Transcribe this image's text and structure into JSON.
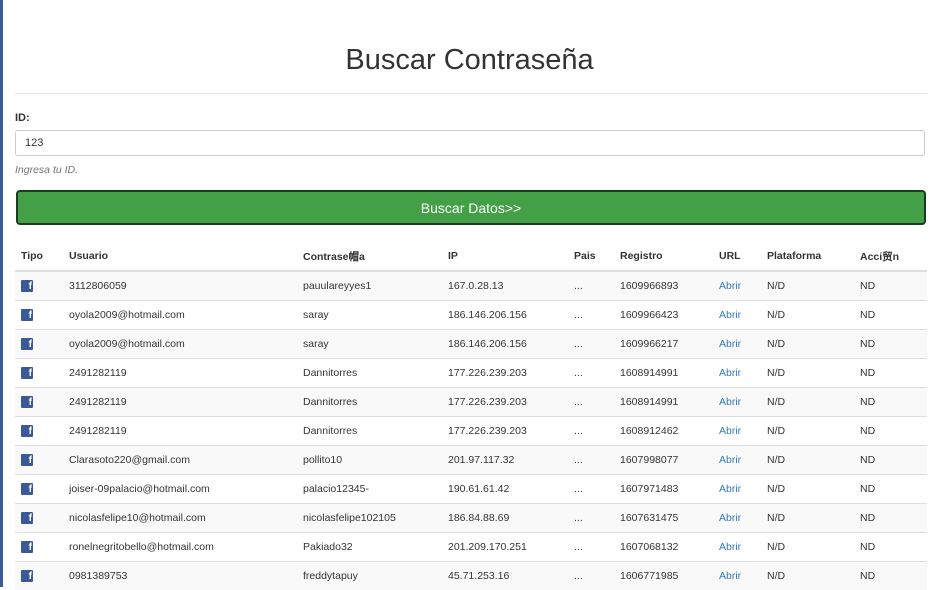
{
  "page": {
    "title": "Buscar Contraseña"
  },
  "form": {
    "id_label": "ID:",
    "id_value": "123",
    "help_text": "Ingresa tu ID.",
    "button_label": "Buscar Datos>>"
  },
  "table": {
    "headers": [
      "Tipo",
      "Usuario",
      "Contrase帽a",
      "IP",
      "Pais",
      "Registro",
      "URL",
      "Plataforma",
      "Acci贸n"
    ],
    "rows": [
      {
        "icon": "facebook-icon",
        "usuario": "3112806059",
        "password": "pauulareyyes1",
        "ip": "167.0.28.13",
        "pais": "...",
        "registro": "1609966893",
        "url": "Abrir",
        "plataforma": "N/D",
        "accion": "ND"
      },
      {
        "icon": "facebook-icon",
        "usuario": "oyola2009@hotmail.com",
        "password": "saray",
        "ip": "186.146.206.156",
        "pais": "...",
        "registro": "1609966423",
        "url": "Abrir",
        "plataforma": "N/D",
        "accion": "ND"
      },
      {
        "icon": "facebook-icon",
        "usuario": "oyola2009@hotmail.com",
        "password": "saray",
        "ip": "186.146.206.156",
        "pais": "...",
        "registro": "1609966217",
        "url": "Abrir",
        "plataforma": "N/D",
        "accion": "ND"
      },
      {
        "icon": "facebook-icon",
        "usuario": "2491282119",
        "password": "Dannitorres",
        "ip": "177.226.239.203",
        "pais": "...",
        "registro": "1608914991",
        "url": "Abrir",
        "plataforma": "N/D",
        "accion": "ND"
      },
      {
        "icon": "facebook-icon",
        "usuario": "2491282119",
        "password": "Dannitorres",
        "ip": "177.226.239.203",
        "pais": "...",
        "registro": "1608914991",
        "url": "Abrir",
        "plataforma": "N/D",
        "accion": "ND"
      },
      {
        "icon": "facebook-icon",
        "usuario": "2491282119",
        "password": "Dannitorres",
        "ip": "177.226.239.203",
        "pais": "...",
        "registro": "1608912462",
        "url": "Abrir",
        "plataforma": "N/D",
        "accion": "ND"
      },
      {
        "icon": "facebook-icon",
        "usuario": "Clarasoto220@gmail.com",
        "password": "pollito10",
        "ip": "201.97.117.32",
        "pais": "...",
        "registro": "1607998077",
        "url": "Abrir",
        "plataforma": "N/D",
        "accion": "ND"
      },
      {
        "icon": "facebook-icon",
        "usuario": "joiser-09palacio@hotmail.com",
        "password": "palacio12345-",
        "ip": "190.61.61.42",
        "pais": "...",
        "registro": "1607971483",
        "url": "Abrir",
        "plataforma": "N/D",
        "accion": "ND"
      },
      {
        "icon": "facebook-icon",
        "usuario": "nicolasfelipe10@hotmail.com",
        "password": "nicolasfelipe102105",
        "ip": "186.84.88.69",
        "pais": "...",
        "registro": "1607631475",
        "url": "Abrir",
        "plataforma": "N/D",
        "accion": "ND"
      },
      {
        "icon": "facebook-icon",
        "usuario": "ronelnegritobello@hotmail.com",
        "password": "Pakiado32",
        "ip": "201.209.170.251",
        "pais": "...",
        "registro": "1607068132",
        "url": "Abrir",
        "plataforma": "N/D",
        "accion": "ND"
      },
      {
        "icon": "facebook-icon",
        "usuario": "0981389753",
        "password": "freddytapuy",
        "ip": "45.71.253.16",
        "pais": "...",
        "registro": "1606771985",
        "url": "Abrir",
        "plataforma": "N/D",
        "accion": "ND"
      }
    ]
  }
}
